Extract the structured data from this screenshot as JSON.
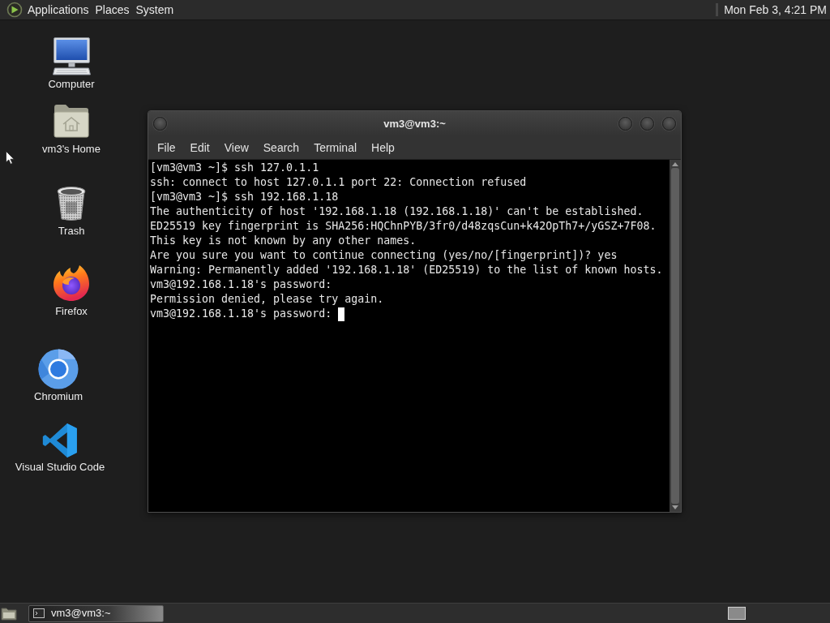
{
  "top_panel": {
    "menus": [
      "Applications",
      "Places",
      "System"
    ],
    "clock": "Mon Feb 3, 4:21 PM"
  },
  "desktop_icons": [
    {
      "kind": "computer",
      "label": "Computer"
    },
    {
      "kind": "home",
      "label": "vm3's Home"
    },
    {
      "kind": "trash",
      "label": "Trash"
    },
    {
      "kind": "firefox",
      "label": "Firefox"
    },
    {
      "kind": "chromium",
      "label": "Chromium"
    },
    {
      "kind": "vscode",
      "label": "Visual Studio Code"
    }
  ],
  "terminal_window": {
    "title": "vm3@vm3:~",
    "menu": [
      "File",
      "Edit",
      "View",
      "Search",
      "Terminal",
      "Help"
    ],
    "lines": [
      "[vm3@vm3 ~]$ ssh 127.0.1.1",
      "ssh: connect to host 127.0.1.1 port 22: Connection refused",
      "[vm3@vm3 ~]$ ssh 192.168.1.18",
      "The authenticity of host '192.168.1.18 (192.168.1.18)' can't be established.",
      "ED25519 key fingerprint is SHA256:HQChnPYB/3fr0/d48zqsCun+k42OpTh7+/yGSZ+7F08.",
      "This key is not known by any other names.",
      "Are you sure you want to continue connecting (yes/no/[fingerprint])? yes",
      "Warning: Permanently added '192.168.1.18' (ED25519) to the list of known hosts.",
      "vm3@192.168.1.18's password:",
      "Permission denied, please try again.",
      "vm3@192.168.1.18's password:"
    ]
  },
  "taskbar": {
    "tasks": [
      {
        "label": "vm3@vm3:~",
        "selected": true
      }
    ]
  }
}
